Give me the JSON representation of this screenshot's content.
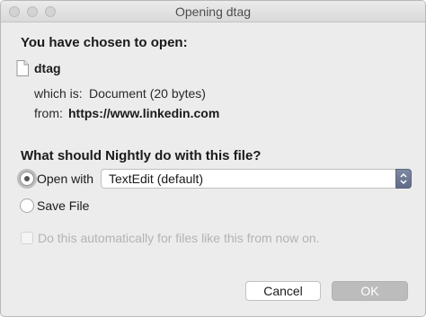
{
  "window": {
    "title": "Opening dtag"
  },
  "intro": {
    "heading": "You have chosen to open:",
    "file_name": "dtag",
    "which_is_label": "which is:",
    "which_is_value": "Document (20 bytes)",
    "from_label": "from:",
    "from_value": "https://www.linkedin.com"
  },
  "action": {
    "question": "What should Nightly do with this file?",
    "open_with_label": "Open with",
    "open_with_selected": true,
    "application": "TextEdit (default)",
    "save_file_label": "Save File",
    "save_file_selected": false
  },
  "auto": {
    "label": "Do this automatically for files like this from now on.",
    "checked": false,
    "enabled": false
  },
  "buttons": {
    "cancel": "Cancel",
    "ok": "OK"
  }
}
